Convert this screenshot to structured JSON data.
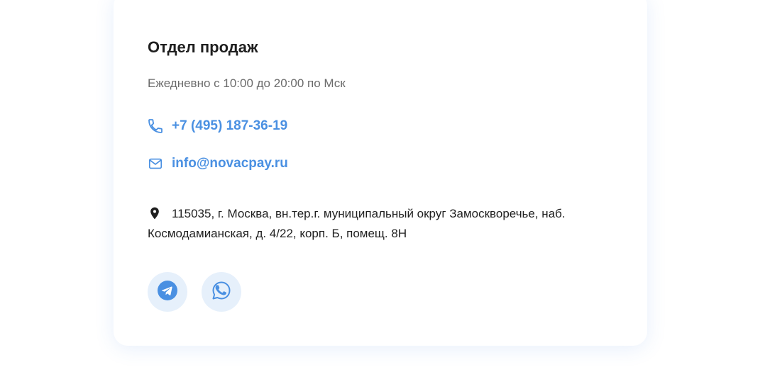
{
  "sales": {
    "title": "Отдел продаж",
    "hours": "Ежедневно с 10:00 до 20:00 по Мск",
    "phone": "+7 (495) 187-36-19",
    "email": "info@novacpay.ru",
    "address": "115035, г. Москва, вн.тер.г. муниципальный округ Замоскворечье, наб. Космодамианская, д. 4/22, корп. Б, помещ. 8Н"
  },
  "icons": {
    "phone": "phone-icon",
    "email": "mail-icon",
    "address": "location-pin-icon",
    "telegram": "telegram-icon",
    "whatsapp": "whatsapp-icon"
  },
  "colors": {
    "accent": "#4a90e2",
    "social_bg": "#e6f0fb",
    "text": "#1f1f1f",
    "muted": "#6b6b6b"
  }
}
